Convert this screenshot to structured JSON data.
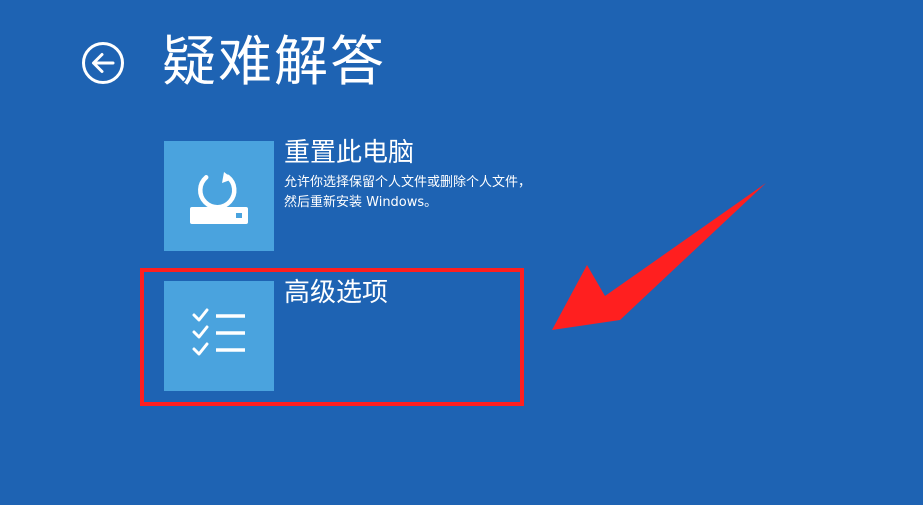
{
  "header": {
    "title": "疑难解答",
    "back_icon": "arrow-left-circle-icon"
  },
  "options": [
    {
      "icon": "reset-pc-icon",
      "title": "重置此电脑",
      "description": "允许你选择保留个人文件或删除个人文件，然后重新安装 Windows。"
    },
    {
      "icon": "checklist-icon",
      "title": "高级选项",
      "description": ""
    }
  ],
  "colors": {
    "background": "#1e63b3",
    "tile": "#4aa3de",
    "annotation": "#ff1f1f"
  }
}
